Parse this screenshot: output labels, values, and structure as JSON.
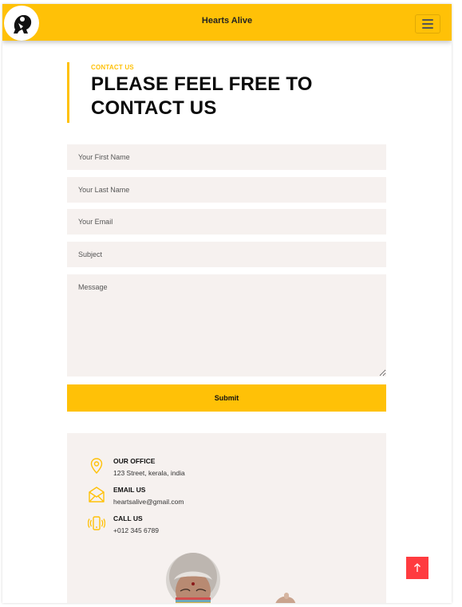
{
  "navbar": {
    "brand": "Hearts Alive",
    "logo_icon": "running-figure-logo",
    "menu_icon": "hamburger-icon"
  },
  "section": {
    "eyebrow": "CONTACT US",
    "title_line1": "PLEASE FEEL FREE TO",
    "title_line2": "CONTACT US"
  },
  "form": {
    "first_name_placeholder": "Your First Name",
    "last_name_placeholder": "Your Last Name",
    "email_placeholder": "Your Email",
    "subject_placeholder": "Subject",
    "message_placeholder": "Message",
    "submit_label": "Submit"
  },
  "contact_info": {
    "office": {
      "icon": "location-pin-icon",
      "title": "OUR OFFICE",
      "text": "123 Street, kerala, india"
    },
    "email": {
      "icon": "envelope-icon",
      "title": "EMAIL US",
      "text": "heartsalive@gmail.com"
    },
    "phone": {
      "icon": "phone-vibrate-icon",
      "title": "CALL US",
      "text": "+012 345 6789"
    }
  },
  "colors": {
    "accent": "#ffc107",
    "field_bg": "#f6f1ef",
    "back_to_top": "#ff3b3f"
  },
  "back_to_top": {
    "icon": "arrow-up-icon"
  }
}
